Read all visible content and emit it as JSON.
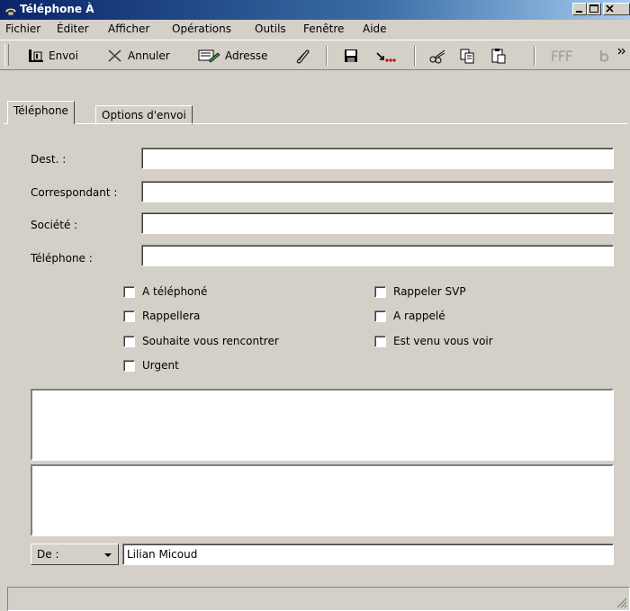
{
  "window": {
    "title": "Téléphone À"
  },
  "menu": [
    {
      "label": "Fichier"
    },
    {
      "label": "Éditer"
    },
    {
      "label": "Afficher"
    },
    {
      "label": "Opérations"
    },
    {
      "label": "Outils"
    },
    {
      "label": "Fenêtre"
    },
    {
      "label": "Aide"
    }
  ],
  "toolbar": {
    "send_label": "Envoi",
    "cancel_label": "Annuler",
    "address_label": "Adresse"
  },
  "tabs": [
    {
      "label": "Téléphone"
    },
    {
      "label": "Options d'envoi"
    }
  ],
  "form": {
    "dest_label": "Dest. :",
    "correspondent_label": "Correspondant :",
    "company_label": "Société :",
    "phone_label": "Téléphone :",
    "dest_value": "",
    "correspondent_value": "",
    "company_value": "",
    "phone_value": ""
  },
  "checkboxes": {
    "left": [
      {
        "label": "A téléphoné",
        "checked": false
      },
      {
        "label": "Rappellera",
        "checked": false
      },
      {
        "label": "Souhaite vous rencontrer",
        "checked": false
      },
      {
        "label": "Urgent",
        "checked": false
      }
    ],
    "right": [
      {
        "label": "Rappeler SVP",
        "checked": false
      },
      {
        "label": "A rappelé",
        "checked": false
      },
      {
        "label": "Est venu vous voir",
        "checked": false
      }
    ]
  },
  "from": {
    "combo_label": "De :",
    "value": "Lilian Micoud"
  },
  "colors": {
    "titlebar_start": "#0a246a",
    "titlebar_end": "#a6caf0",
    "face": "#d4d0c8"
  }
}
